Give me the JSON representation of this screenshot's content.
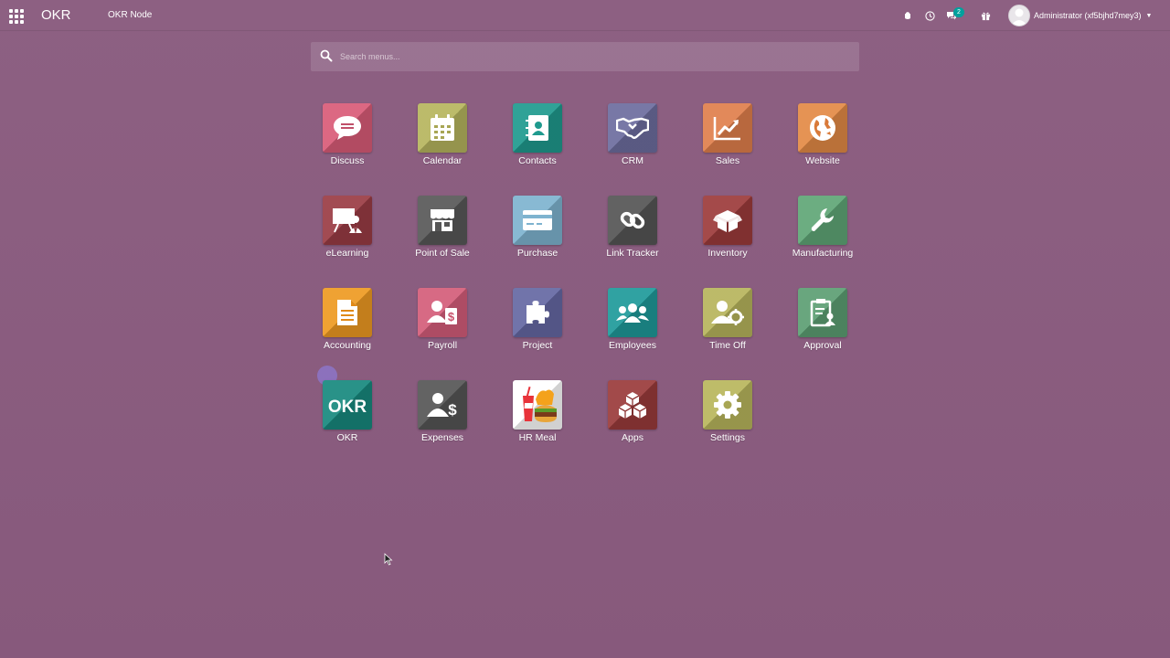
{
  "topbar": {
    "brand": "OKR",
    "subbrand": "OKR Node",
    "message_badge": "2",
    "user_name": "Administrator (xf5bjhd7mey3)"
  },
  "search": {
    "placeholder": "Search menus..."
  },
  "apps": [
    {
      "label": "Discuss",
      "color": "#d95b78",
      "icon": "chat-bubble-icon"
    },
    {
      "label": "Calendar",
      "color": "#b6b55e",
      "icon": "calendar-icon"
    },
    {
      "label": "Contacts",
      "color": "#1f9a8e",
      "icon": "address-book-icon"
    },
    {
      "label": "CRM",
      "color": "#6d6d9e",
      "icon": "handshake-icon"
    },
    {
      "label": "Sales",
      "color": "#e07f4c",
      "icon": "trend-chart-icon"
    },
    {
      "label": "Website",
      "color": "#e38a45",
      "icon": "globe-icon"
    },
    {
      "label": "eLearning",
      "color": "#9a3c44",
      "icon": "presenter-board-icon"
    },
    {
      "label": "Point of Sale",
      "color": "#585858",
      "icon": "storefront-icon"
    },
    {
      "label": "Purchase",
      "color": "#7eb3cf",
      "icon": "credit-card-icon"
    },
    {
      "label": "Link Tracker",
      "color": "#555555",
      "icon": "link-icon"
    },
    {
      "label": "Inventory",
      "color": "#9c3b3b",
      "icon": "open-box-icon"
    },
    {
      "label": "Manufacturing",
      "color": "#5fa676",
      "icon": "wrench-icon"
    },
    {
      "label": "Accounting",
      "color": "#ee9a22",
      "icon": "document-icon"
    },
    {
      "label": "Payroll",
      "color": "#d45d7a",
      "icon": "user-dollar-icon"
    },
    {
      "label": "Project",
      "color": "#6568a3",
      "icon": "puzzle-icon"
    },
    {
      "label": "Employees",
      "color": "#1e9a9a",
      "icon": "users-icon"
    },
    {
      "label": "Time Off",
      "color": "#b7b45c",
      "icon": "user-gear-icon"
    },
    {
      "label": "Approval",
      "color": "#5c9e73",
      "icon": "clipboard-user-icon"
    },
    {
      "label": "OKR",
      "color": "#17897e",
      "icon": "okr-logo-icon",
      "logo_text": "OKR"
    },
    {
      "label": "Expenses",
      "color": "#565656",
      "icon": "user-dollar-icon"
    },
    {
      "label": "HR Meal",
      "color": "#ffffff",
      "icon": "meal-icon"
    },
    {
      "label": "Apps",
      "color": "#9a3b3b",
      "icon": "cubes-icon"
    },
    {
      "label": "Settings",
      "color": "#b8b65c",
      "icon": "gear-icon"
    }
  ]
}
